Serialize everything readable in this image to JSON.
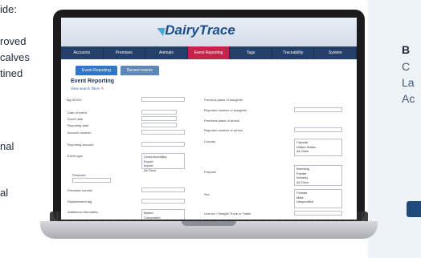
{
  "left_text": [
    "ide:",
    "roved",
    "calves",
    "tined",
    "nal",
    "al"
  ],
  "right_text": [
    "B",
    "C",
    "La",
    "Ac"
  ],
  "app": {
    "logo": "DairyTrace",
    "nav": [
      "Accounts",
      "Premises",
      "Animals",
      "Event Reporting",
      "Tags",
      "Traceability",
      "System"
    ],
    "tabs": [
      "Event Reporting",
      "Recent events"
    ],
    "page_title": "Event Reporting",
    "page_link": "View search filters",
    "left_labels": [
      "Tag ID/VID",
      "Date of event",
      "Event date",
      "Reporting date",
      "Account number",
      "Reporting account",
      "Event type",
      "Postcode",
      "Premises number",
      "Replacement tag",
      "Additional information"
    ],
    "event_type_options": [
      "Cross-boundary",
      "Export",
      "Import",
      "All Clear"
    ],
    "additional_options": [
      "Buried",
      "Composted"
    ],
    "right_labels": [
      "Previous place of slaughter",
      "Reported number of slaughter",
      "Premises place of arrival",
      "Reported number of arrival",
      "Country",
      "Purpose",
      "Sex",
      "Licence / Straight Truck or Trailer"
    ],
    "country_options": [
      "Canada",
      "United States",
      "All Clear"
    ],
    "purpose_options": [
      "Breeding",
      "Feeder",
      "Industry",
      "All Clear"
    ],
    "sex_options": [
      "Female",
      "Male",
      "Unspecified"
    ]
  }
}
